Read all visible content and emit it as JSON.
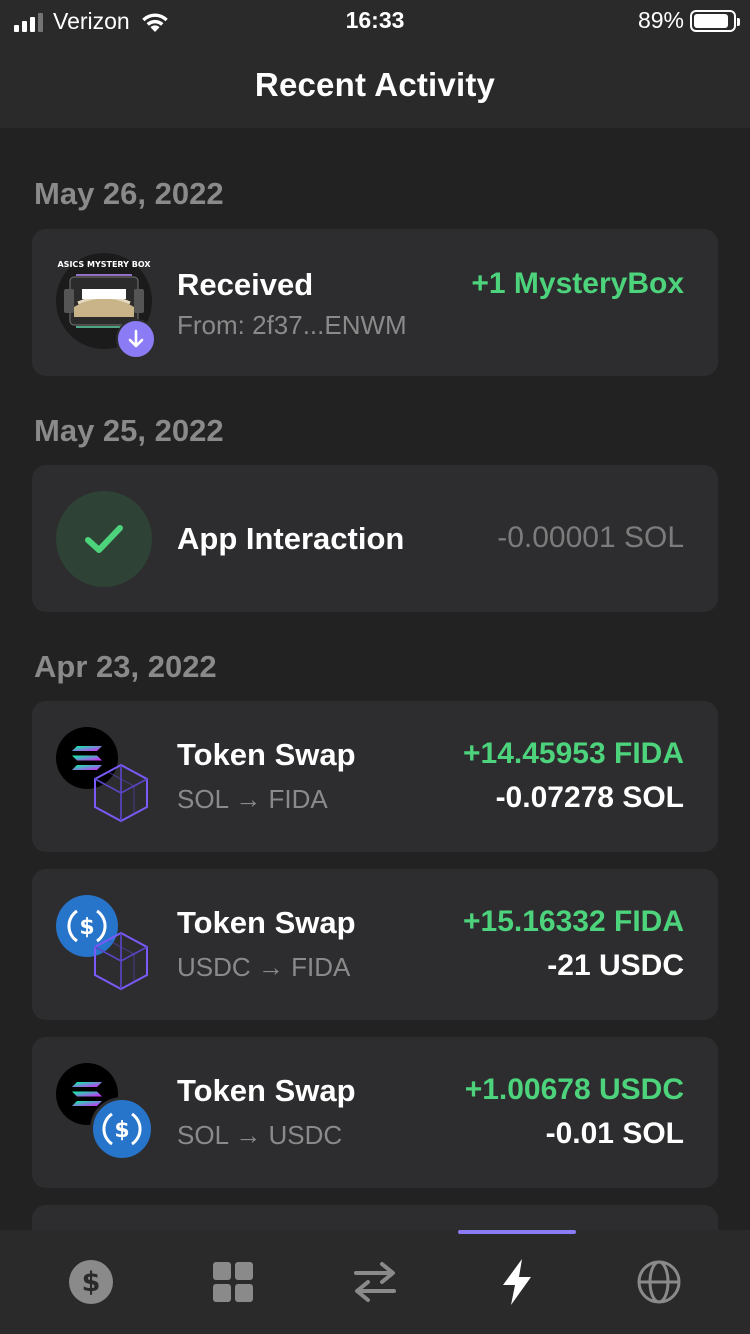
{
  "status_bar": {
    "carrier": "Verizon",
    "time": "16:33",
    "battery": "89%",
    "battery_level": 0.89
  },
  "header": {
    "title": "Recent Activity"
  },
  "groups": [
    {
      "date": "May 26, 2022",
      "items": [
        {
          "icon": "asics-mystery-box-nft",
          "badge_icon": "arrow-down-icon",
          "nft_text": "ASICS MYSTERY BOX",
          "title": "Received",
          "subtitle": "From: 2f37...ENWM",
          "amount_primary": "+1 MysteryBox"
        }
      ]
    },
    {
      "date": "May 25, 2022",
      "items": [
        {
          "icon": "checkmark-icon",
          "title": "App Interaction",
          "amount_primary": "-0.00001 SOL"
        }
      ]
    },
    {
      "date": "Apr 23, 2022",
      "items": [
        {
          "icon": "solana-fida-icon",
          "title": "Token Swap",
          "subtitle": "SOL → FIDA",
          "amount_primary": "+14.45953 FIDA",
          "amount_secondary": "-0.07278 SOL"
        },
        {
          "icon": "usdc-fida-icon",
          "title": "Token Swap",
          "subtitle": "USDC → FIDA",
          "amount_primary": "+15.16332 FIDA",
          "amount_secondary": "-21 USDC"
        },
        {
          "icon": "solana-usdc-icon",
          "title": "Token Swap",
          "subtitle": "SOL → USDC",
          "amount_primary": "+1.00678 USDC",
          "amount_secondary": "-0.01 SOL"
        }
      ]
    }
  ],
  "tabbar": {
    "tabs": [
      {
        "icon": "dollar-icon",
        "active": false
      },
      {
        "icon": "grid-icon",
        "active": false
      },
      {
        "icon": "swap-arrows-icon",
        "active": false
      },
      {
        "icon": "lightning-icon",
        "active": true
      },
      {
        "icon": "globe-icon",
        "active": false
      }
    ]
  },
  "colors": {
    "background": "#222222",
    "card": "#2d2d2f",
    "positive": "#4cd37b",
    "muted": "#8a8a8a",
    "accent": "#8b7cf6",
    "usdc_blue": "#2775ca"
  }
}
